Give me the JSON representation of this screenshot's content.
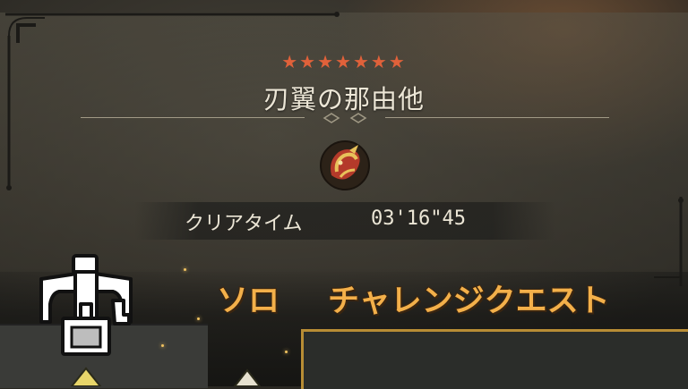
{
  "quest": {
    "stars": "★★★★★★★",
    "title": "刃翼の那由他",
    "clear_time_label": "クリアタイム",
    "clear_time_value": "03'16\"45"
  },
  "caption": {
    "left": "ソロ",
    "right": "チャレンジクエスト"
  },
  "icons": {
    "monster": "monster-emblem-icon",
    "weapon": "charge-blade-icon"
  },
  "colors": {
    "star": "#e0613a",
    "caption_fill": "#f3b04a",
    "caption_outline": "#3a2510"
  }
}
